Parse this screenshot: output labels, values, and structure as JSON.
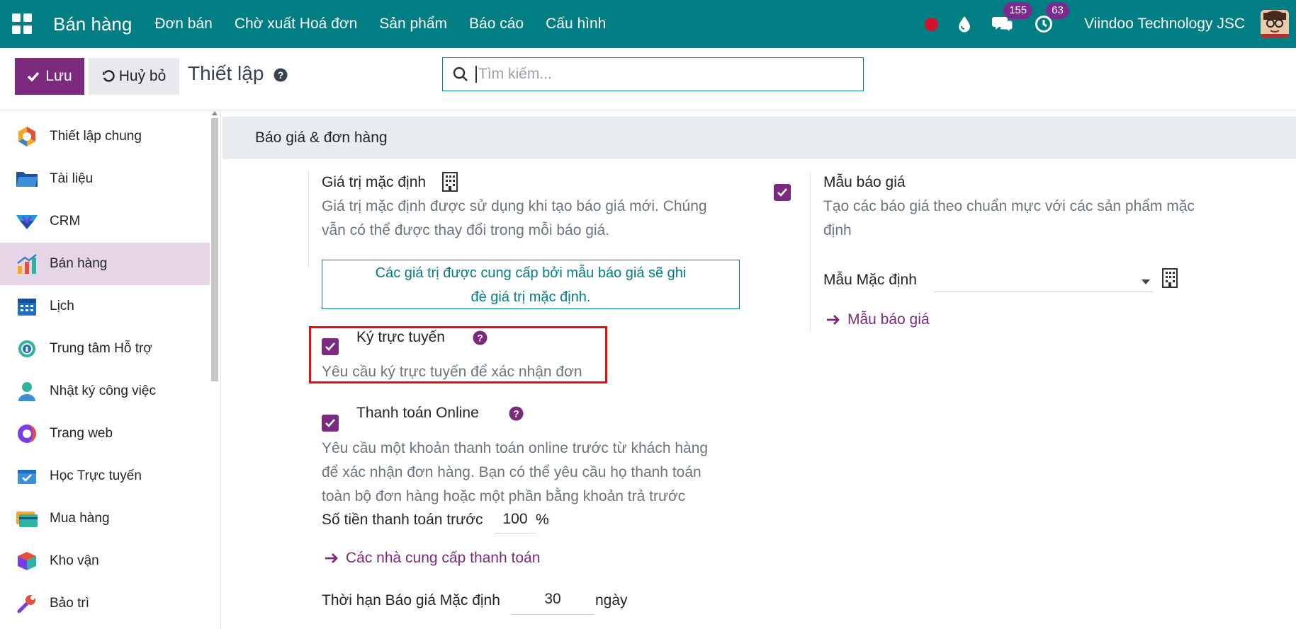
{
  "topnav": {
    "brand": "Bán hàng",
    "menu": [
      "Đơn bán",
      "Chờ xuất Hoá đơn",
      "Sản phẩm",
      "Báo cáo",
      "Cấu hình"
    ],
    "messages_count": "155",
    "activities_count": "63",
    "company": "Viindoo Technology JSC"
  },
  "control_panel": {
    "save_label": "Lưu",
    "cancel_label": "Huỷ bỏ",
    "title": "Thiết lập",
    "search_placeholder": "Tìm kiếm..."
  },
  "sidebar": {
    "items": [
      {
        "label": "Thiết lập chung",
        "icon": "settings-icon"
      },
      {
        "label": "Tài liệu",
        "icon": "folder-icon"
      },
      {
        "label": "CRM",
        "icon": "crm-icon"
      },
      {
        "label": "Bán hàng",
        "icon": "sales-chart-icon",
        "active": true
      },
      {
        "label": "Lịch",
        "icon": "calendar-icon"
      },
      {
        "label": "Trung tâm Hỗ trợ",
        "icon": "helpdesk-icon"
      },
      {
        "label": "Nhật ký công việc",
        "icon": "timesheet-icon"
      },
      {
        "label": "Trang web",
        "icon": "website-icon"
      },
      {
        "label": "Học Trực tuyến",
        "icon": "elearning-icon"
      },
      {
        "label": "Mua hàng",
        "icon": "purchase-icon"
      },
      {
        "label": "Kho vận",
        "icon": "inventory-icon"
      },
      {
        "label": "Bảo trì",
        "icon": "maintenance-icon"
      }
    ]
  },
  "section": {
    "title": "Báo giá & đơn hàng"
  },
  "settings": {
    "default_values": {
      "label": "Giá trị mặc định",
      "desc_line1": "Giá trị mặc định được sử dụng khi tạo báo giá mới. Chúng",
      "desc_line2": "vẫn có thể được thay đổi trong mỗi báo giá.",
      "info_line1": "Các giá trị được cung cấp bởi mẫu báo giá sẽ ghi",
      "info_line2": "đè giá trị mặc định."
    },
    "quotation_template": {
      "label": "Mẫu báo giá",
      "checked": true,
      "desc_line1": "Tạo các báo giá theo chuẩn mực với các sản phẩm mặc",
      "desc_line2": "định",
      "default_template_label": "Mẫu Mặc định",
      "default_template_value": "",
      "link_label": "Mẫu báo giá"
    },
    "online_signature": {
      "label": "Ký trực tuyến",
      "checked": true,
      "desc": "Yêu cầu ký trực tuyến để xác nhận đơn"
    },
    "online_payment": {
      "label": "Thanh toán Online",
      "checked": true,
      "desc_line1": "Yêu cầu một khoản thanh toán online trước từ khách hàng",
      "desc_line2": "để xác nhận đơn hàng. Bạn có thể yêu cầu họ thanh toán",
      "desc_line3": "toàn bộ đơn hàng hoặc một phần bằng khoản trả trước",
      "prepayment_label": "Số tiền thanh toán trước",
      "prepayment_value": "100",
      "prepayment_unit": "%",
      "link_label": "Các nhà cung cấp thanh toán"
    },
    "validity": {
      "label": "Thời hạn Báo giá Mặc định",
      "value": "30",
      "unit": "ngày"
    }
  },
  "colors": {
    "navbar": "#017e84",
    "primary": "#7c2a7e",
    "highlight_border": "#e01010",
    "sidebar_active": "#e6d5e7"
  }
}
